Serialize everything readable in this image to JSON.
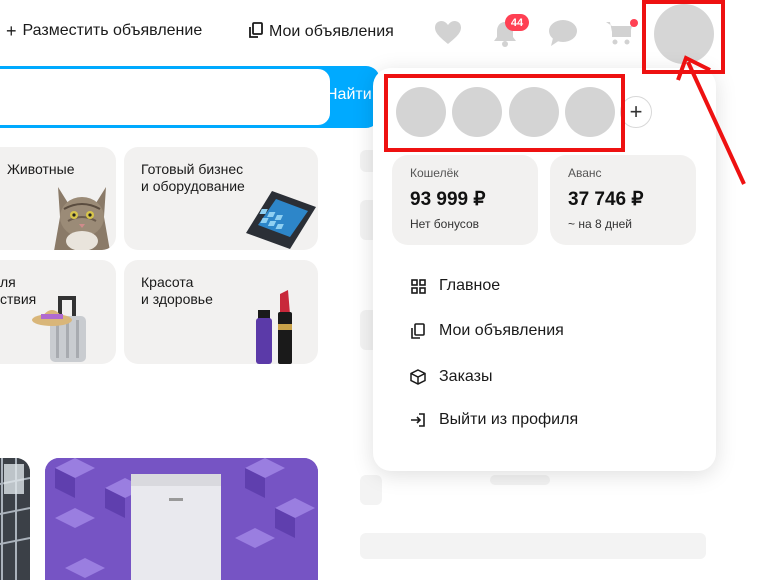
{
  "header": {
    "post_ad": {
      "icon": "+",
      "label": "Разместить объявление"
    },
    "my_ads": {
      "icon": "copy-icon",
      "label": "Мои объявления"
    },
    "notifications_count": "44",
    "icons": [
      "heart-icon",
      "bell-icon",
      "chat-icon",
      "cart-icon"
    ]
  },
  "search": {
    "button_label": "Найти",
    "placeholder": ""
  },
  "categories": [
    {
      "label": "Животные"
    },
    {
      "label": "Готовый бизнес\nи оборудование"
    },
    {
      "label": "ля\nствия"
    },
    {
      "label": "Красота\nи здоровье"
    }
  ],
  "dropdown": {
    "add_account": "+",
    "wallet": {
      "title": "Кошелёк",
      "amount": "93 999 ₽",
      "sub": "Нет бонусов"
    },
    "advance": {
      "title": "Аванс",
      "amount": "37 746 ₽",
      "sub": "~ на 8 дней"
    },
    "menu": [
      {
        "icon": "grid-icon",
        "label": "Главное"
      },
      {
        "icon": "copy-icon",
        "label": "Мои объявления"
      },
      {
        "icon": "box-icon",
        "label": "Заказы"
      },
      {
        "icon": "logout-icon",
        "label": "Выйти из профиля"
      }
    ]
  },
  "colors": {
    "accent": "#00aaff",
    "badge": "#ff4053",
    "annotation": "#ee1111"
  }
}
